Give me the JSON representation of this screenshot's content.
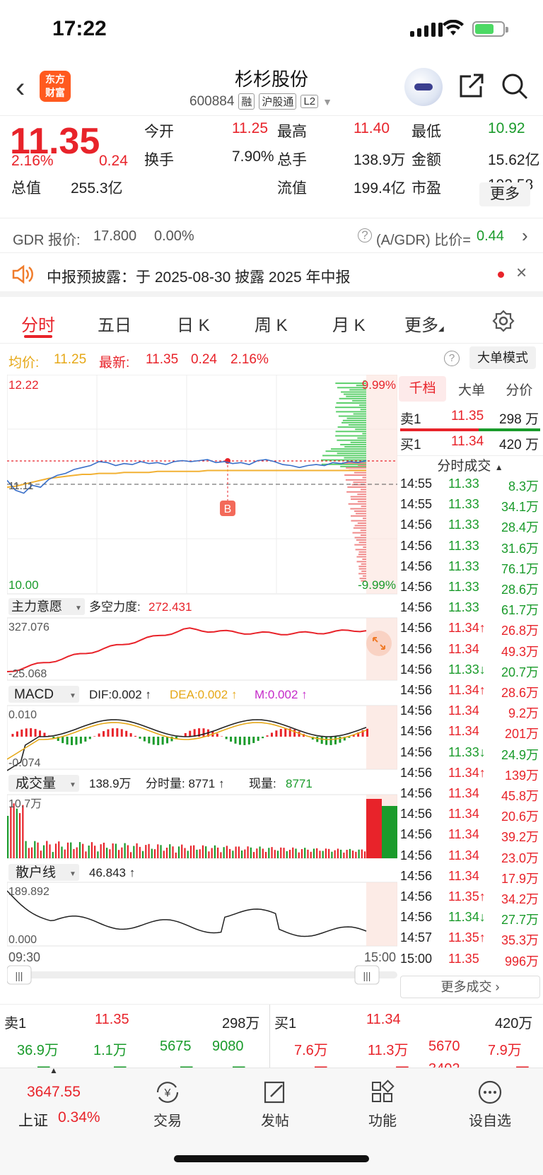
{
  "status_bar": {
    "time": "17:22"
  },
  "header": {
    "logo_line1": "东方",
    "logo_line2": "财富",
    "stock_name": "杉杉股份",
    "code": "600884",
    "tags": [
      "融",
      "沪股通",
      "L2"
    ]
  },
  "quote": {
    "price": "11.35",
    "change_pct": "2.16%",
    "change": "0.24",
    "cells": [
      {
        "label": "今开",
        "value": "11.25",
        "color": "#e8232a"
      },
      {
        "label": "最高",
        "value": "11.40",
        "color": "#e8232a"
      },
      {
        "label": "最低",
        "value": "10.92",
        "color": "#1a9b2b"
      },
      {
        "label": "换手",
        "value": "7.90%",
        "color": "#222"
      },
      {
        "label": "总手",
        "value": "138.9万",
        "color": "#222"
      },
      {
        "label": "金额",
        "value": "15.62亿",
        "color": "#222"
      },
      {
        "label": "总值",
        "value": "255.3亿",
        "color": "#222"
      },
      {
        "label": "流值",
        "value": "199.4亿",
        "color": "#222"
      },
      {
        "label": "市盈",
        "value": "192.58",
        "color": "#222"
      }
    ],
    "pe_sup": "动",
    "more": "更多"
  },
  "gdr": {
    "label": "GDR 报价:",
    "price": "17.800",
    "pct": "0.00%",
    "ratio_label": "(A/GDR) 比价=",
    "ratio": "0.44"
  },
  "notice": {
    "text": "中报预披露：于 2025-08-30 披露 2025 年中报"
  },
  "tabs": [
    "分时",
    "五日",
    "日 K",
    "周 K",
    "月 K",
    "更多"
  ],
  "infobar": {
    "avg_label": "均价:",
    "avg": "11.25",
    "latest_label": "最新:",
    "latest": "11.35",
    "change": "0.24",
    "pct": "2.16%",
    "mode_button": "大单模式"
  },
  "chart_data": {
    "type": "line",
    "main": {
      "ymax": "12.22",
      "ymin": "10.00",
      "pct_top": "9.99%",
      "pct_bottom": "-9.99%",
      "prev_close": "11.11",
      "price_series": [
        11.15,
        11.05,
        11.02,
        11.1,
        11.08,
        11.16,
        11.2,
        11.22,
        11.26,
        11.28,
        11.3,
        11.34,
        11.33,
        11.3,
        11.32,
        11.31,
        11.34,
        11.32,
        11.33,
        11.31,
        11.34,
        11.35,
        11.34,
        11.35,
        11.36,
        11.33,
        11.34,
        11.32,
        11.33,
        11.31,
        11.35,
        11.36,
        11.34,
        11.31,
        11.3,
        11.28,
        11.3,
        11.31,
        11.3,
        11.33,
        11.32,
        11.34,
        11.33,
        11.35
      ],
      "avg_series": [
        11.08,
        11.09,
        11.11,
        11.13,
        11.15,
        11.17,
        11.18,
        11.19,
        11.2,
        11.21,
        11.21,
        11.22,
        11.22,
        11.22,
        11.23,
        11.23,
        11.23,
        11.23,
        11.24,
        11.24,
        11.24,
        11.24,
        11.24,
        11.24,
        11.25,
        11.25,
        11.25,
        11.25,
        11.25,
        11.25,
        11.25,
        11.25,
        11.25,
        11.25,
        11.25,
        11.25,
        11.25,
        11.25,
        11.25,
        11.25,
        11.25,
        11.25,
        11.25,
        11.25
      ],
      "x_start": "09:30",
      "x_end": "15:00"
    },
    "zhuli": {
      "title": "主力意愿",
      "label": "多空力度:",
      "value": "272.431",
      "ymax": "327.076",
      "ymin": "-25.068"
    },
    "macd": {
      "title": "MACD",
      "dif": "DIF:0.002 ↑",
      "dea": "DEA:0.002 ↑",
      "m": "M:0.002 ↑",
      "ymax": "0.010",
      "ymin": "-0.074"
    },
    "volume": {
      "title": "成交量",
      "total": "138.9万",
      "fenshi": "分时量: 8771 ↑",
      "now_label": "现量:",
      "now": "8771",
      "ymax": "10.7万"
    },
    "sanhu": {
      "title": "散户线",
      "value": "46.843 ↑",
      "ymax": "189.892",
      "ymin": "0.000"
    }
  },
  "right_panel": {
    "tabs": [
      "千档",
      "大单",
      "分价"
    ],
    "sell1": {
      "label": "卖1",
      "price": "11.35",
      "vol": "298 万"
    },
    "buy1": {
      "label": "买1",
      "price": "11.34",
      "vol": "420 万"
    },
    "ticks_title": "分时成交",
    "ticks": [
      {
        "t": "14:55",
        "p": "11.33",
        "v": "8.3万",
        "c": "g"
      },
      {
        "t": "14:55",
        "p": "11.33",
        "v": "34.1万",
        "c": "g"
      },
      {
        "t": "14:56",
        "p": "11.33",
        "v": "28.4万",
        "c": "g"
      },
      {
        "t": "14:56",
        "p": "11.33",
        "v": "31.6万",
        "c": "g"
      },
      {
        "t": "14:56",
        "p": "11.33",
        "v": "76.1万",
        "c": "g"
      },
      {
        "t": "14:56",
        "p": "11.33",
        "v": "28.6万",
        "c": "g"
      },
      {
        "t": "14:56",
        "p": "11.33",
        "v": "61.7万",
        "c": "g"
      },
      {
        "t": "14:56",
        "p": "11.34↑",
        "v": "26.8万",
        "c": "r"
      },
      {
        "t": "14:56",
        "p": "11.34",
        "v": "49.3万",
        "c": "r"
      },
      {
        "t": "14:56",
        "p": "11.33↓",
        "v": "20.7万",
        "c": "g"
      },
      {
        "t": "14:56",
        "p": "11.34↑",
        "v": "28.6万",
        "c": "r"
      },
      {
        "t": "14:56",
        "p": "11.34",
        "v": "9.2万",
        "c": "r"
      },
      {
        "t": "14:56",
        "p": "11.34",
        "v": "201万",
        "c": "r"
      },
      {
        "t": "14:56",
        "p": "11.33↓",
        "v": "24.9万",
        "c": "g"
      },
      {
        "t": "14:56",
        "p": "11.34↑",
        "v": "139万",
        "c": "r"
      },
      {
        "t": "14:56",
        "p": "11.34",
        "v": "45.8万",
        "c": "r"
      },
      {
        "t": "14:56",
        "p": "11.34",
        "v": "20.6万",
        "c": "r"
      },
      {
        "t": "14:56",
        "p": "11.34",
        "v": "39.2万",
        "c": "r"
      },
      {
        "t": "14:56",
        "p": "11.34",
        "v": "23.0万",
        "c": "r"
      },
      {
        "t": "14:56",
        "p": "11.34",
        "v": "17.9万",
        "c": "r"
      },
      {
        "t": "14:56",
        "p": "11.35↑",
        "v": "34.2万",
        "c": "r"
      },
      {
        "t": "14:56",
        "p": "11.34↓",
        "v": "27.7万",
        "c": "g"
      },
      {
        "t": "14:57",
        "p": "11.35↑",
        "v": "35.3万",
        "c": "r"
      },
      {
        "t": "15:00",
        "p": "11.35",
        "v": "996万",
        "c": "r"
      }
    ],
    "more_ticks": "更多成交"
  },
  "bottom_book": {
    "sell": {
      "label": "卖1",
      "price": "11.35",
      "vol": "298万",
      "row1": [
        "36.9万",
        "1.1万",
        "5675",
        "9080"
      ],
      "row2": [
        "1.4万",
        "1.1万",
        "1.7万",
        "1.1万"
      ]
    },
    "buy": {
      "label": "买1",
      "price": "11.34",
      "vol": "420万",
      "row1": [
        "7.6万",
        "11.3万",
        "5670",
        "7.9万"
      ],
      "row2": [
        "3.7万",
        "49.9万",
        "3402",
        "10.7万"
      ]
    }
  },
  "nav": {
    "index_value": "3647.55",
    "index_name": "上证",
    "index_pct": "0.34%",
    "items": [
      {
        "label": "交易",
        "icon": "yuan-exchange-icon"
      },
      {
        "label": "发帖",
        "icon": "edit-icon"
      },
      {
        "label": "功能",
        "icon": "grid-icon"
      },
      {
        "label": "设自选",
        "icon": "more-dots-icon"
      }
    ]
  }
}
